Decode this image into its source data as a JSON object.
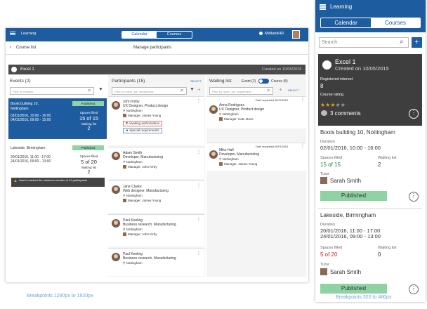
{
  "desktop": {
    "app_title": "Learning",
    "tabs": [
      "Calendar",
      "Courses"
    ],
    "active_tab": "Calendar",
    "user": "MidlandHR",
    "back_link": "Course list",
    "page_title": "Manage participants",
    "course": {
      "name": "Excel 1",
      "created": "Created on 10/05/2015"
    },
    "events": {
      "title": "Events (2)",
      "search_placeholder": "Filter by location...",
      "items": [
        {
          "location": "Boots building 10, Nottingham",
          "dates": [
            "02/01/2016, 10:00 - 16:00",
            "04/01/2016, 09:00 - 15:00"
          ],
          "status": "Published",
          "spaces_label": "Spaces filled",
          "spaces": "15 of 15",
          "waiting_label": "Waiting list",
          "waiting": "2",
          "selected": true
        },
        {
          "location": "Lakeside, Birmingham",
          "dates": [
            "20/01/2016, 11:00 - 17:00",
            "24/01/2016, 09:00 - 13:00"
          ],
          "status": "Published",
          "spaces_label": "Spaces filled",
          "spaces": "5 of 20",
          "waiting_label": "Waiting list",
          "waiting": "2",
          "warning": "Hasn't reached the minimum number of 12 participants",
          "selected": false
        }
      ],
      "breakpoint_note": "Breakpoints 1280px to 1920px"
    },
    "participants": {
      "title": "Participants (15)",
      "select_label": "SELECT",
      "search_placeholder": "Filter by name, job, department...",
      "items": [
        {
          "name": "John Kirby",
          "role": "UX Designer, Product design",
          "location": "Nottingham",
          "manager": "Manager: James Young",
          "tags": [
            "Awaiting authorisation",
            "Special requirements"
          ]
        },
        {
          "name": "Adam Smith",
          "role": "Developer, Manufacturing",
          "location": "Nottingham",
          "manager": "Manager: John Kirby"
        },
        {
          "name": "Jane Clarke",
          "role": "Web designer, Manufacturing",
          "location": "Nottingham",
          "manager": "Manager: James Young"
        },
        {
          "name": "Paul Keeling",
          "role": "Business research, Manufacturing",
          "location": "Nottingham",
          "manager": "Manager: John Kirby"
        },
        {
          "name": "Paul Keeling",
          "role": "Business research, Manufacturing",
          "location": "Nottingham"
        }
      ]
    },
    "waiting": {
      "title": "Waiting list:",
      "toggle_left": "Event (2)",
      "toggle_right": "Course (8)",
      "select_label": "SELECT",
      "search_placeholder": "Filter by name, job, department...",
      "items": [
        {
          "requested": "Date requested 28/12/2015",
          "name": "Anna Rodriguez",
          "role": "UX Designer, Product design",
          "location": "Nottingham",
          "manager": "Manager: Kate Moss"
        },
        {
          "requested": "Date requested 05/01/2016",
          "name": "Mike Hall",
          "role": "Developer, Manufacturing",
          "location": "Nottingham",
          "manager": "Manager: James Young"
        }
      ]
    }
  },
  "mobile": {
    "app_title": "Learning",
    "tabs": [
      "Calendar",
      "Courses"
    ],
    "active_tab": "Courses",
    "search_placeholder": "Search",
    "course": {
      "name": "Excel 1",
      "created": "Created on 10/05/2015",
      "interest_label": "Registered interest",
      "interest": "8",
      "rating_label": "Course rating",
      "rating": 3,
      "rating_max": 5,
      "comments": "3 comments"
    },
    "events": [
      {
        "location": "Boots building 10, Nottingham",
        "duration_label": "Duration",
        "duration": [
          "02/01/2016, 10:00 - 16:00"
        ],
        "spaces_label": "Spaces filled",
        "spaces": "15 of 15",
        "waiting_label": "Waiting list",
        "waiting": "2",
        "tutor_label": "Tutor",
        "tutor": "Sarah Smith",
        "status": "Published"
      },
      {
        "location": "Lakeside, Birmingham",
        "duration_label": "Duration",
        "duration": [
          "20/01/2016, 11:00 - 17:00",
          "24/01/2016, 09:00 - 13:00"
        ],
        "spaces_label": "Spaces filled",
        "spaces": "5 of 20",
        "waiting_label": "Waiting list",
        "waiting": "0",
        "tutor_label": "Tutor",
        "tutor": "Sarah Smith",
        "status": "Published"
      }
    ],
    "breakpoint_note": "Breakpoints 320 to 480px"
  },
  "colors": {
    "brand": "#1d5c9e",
    "published": "#8fd3a5",
    "green_value": "#2f7a3a",
    "red_value": "#c0292c"
  }
}
